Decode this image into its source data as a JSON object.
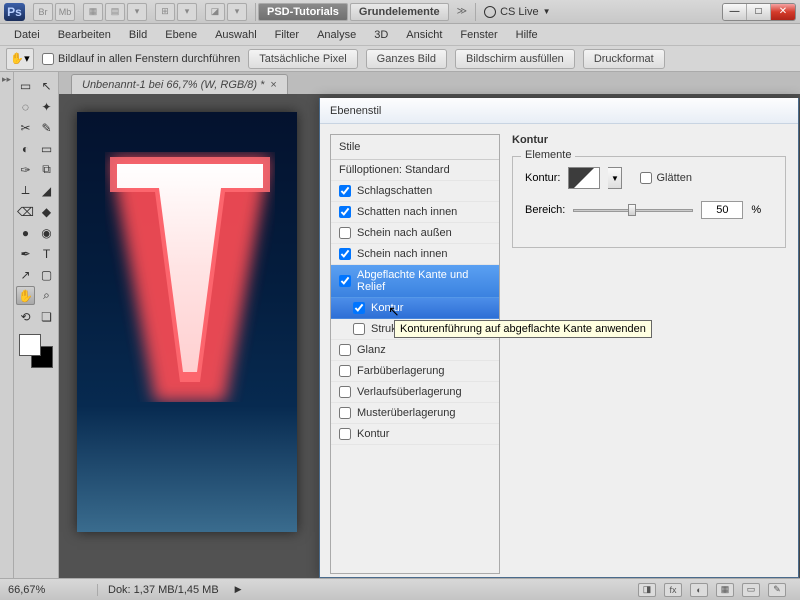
{
  "top": {
    "ps": "Ps",
    "toggles": [
      "Br",
      "Mb"
    ],
    "presets": {
      "active": "PSD-Tutorials",
      "inactive": "Grundelemente"
    },
    "cslive": "CS Live"
  },
  "winbtn": {
    "min": "—",
    "max": "□",
    "close": "✕"
  },
  "menu": [
    "Datei",
    "Bearbeiten",
    "Bild",
    "Ebene",
    "Auswahl",
    "Filter",
    "Analyse",
    "3D",
    "Ansicht",
    "Fenster",
    "Hilfe"
  ],
  "opt": {
    "scroll_all": "Bildlauf in allen Fenstern durchführen",
    "btns": [
      "Tatsächliche Pixel",
      "Ganzes Bild",
      "Bildschirm ausfüllen",
      "Druckformat"
    ]
  },
  "doc": {
    "tab": "Unbenannt-1 bei 66,7% (W, RGB/8) *"
  },
  "dialog": {
    "title": "Ebenenstil",
    "stile": "Stile",
    "fulloptionen": "Fülloptionen: Standard",
    "items": [
      {
        "label": "Schlagschatten",
        "checked": true
      },
      {
        "label": "Schatten nach innen",
        "checked": true
      },
      {
        "label": "Schein nach außen",
        "checked": false
      },
      {
        "label": "Schein nach innen",
        "checked": true
      },
      {
        "label": "Abgeflachte Kante und Relief",
        "checked": true,
        "section": true
      },
      {
        "label": "Kontur",
        "checked": true,
        "indent": true,
        "selected": true
      },
      {
        "label": "Struktur",
        "checked": false,
        "indent": true
      },
      {
        "label": "Glanz",
        "checked": false
      },
      {
        "label": "Farbüberlagerung",
        "checked": false
      },
      {
        "label": "Verlaufsüberlagerung",
        "checked": false
      },
      {
        "label": "Musterüberlagerung",
        "checked": false
      },
      {
        "label": "Kontur",
        "checked": false
      }
    ],
    "tooltip": "Konturenführung auf abgeflachte Kante anwenden",
    "props": {
      "hdr": "Kontur",
      "elemente": "Elemente",
      "kontur_lbl": "Kontur:",
      "glaetten": "Glätten",
      "bereich_lbl": "Bereich:",
      "bereich_val": "50",
      "bereich_unit": "%"
    }
  },
  "status": {
    "zoom": "66,67%",
    "dok": "Dok: 1,37 MB/1,45 MB"
  },
  "tools": [
    [
      "▭",
      "↖"
    ],
    [
      "◌",
      "✦"
    ],
    [
      "✂",
      "✎"
    ],
    [
      "◐",
      "▭"
    ],
    [
      "✑",
      "⧉"
    ],
    [
      "⟂",
      "◢"
    ],
    [
      "⌫",
      "◆"
    ],
    [
      "●",
      "◉"
    ],
    [
      "✒",
      "T"
    ],
    [
      "↗",
      "▢"
    ],
    [
      "✋",
      "⌕"
    ],
    [
      "⟲",
      "❏"
    ]
  ]
}
